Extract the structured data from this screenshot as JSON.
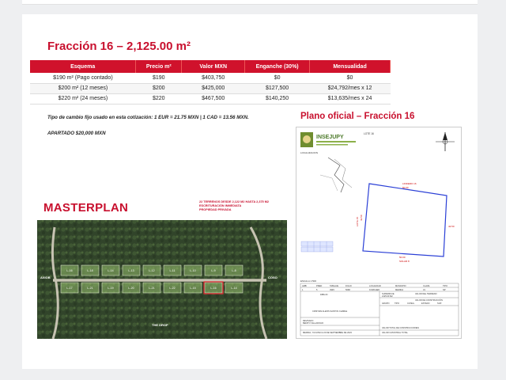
{
  "title": "Fracción 16 – 2,125.00 m²",
  "pricing": {
    "headers": [
      "Esquema",
      "Precio m²",
      "Valor MXN",
      "Enganche (30%)",
      "Mensualidad"
    ],
    "rows": [
      [
        "$190 m² (Pago contado)",
        "$190",
        "$403,750",
        "$0",
        "$0"
      ],
      [
        "$200 m² (12 meses)",
        "$200",
        "$425,000",
        "$127,500",
        "$24,792/mes x 12"
      ],
      [
        "$220 m² (24 meses)",
        "$220",
        "$467,500",
        "$140,250",
        "$13,635/mes x 24"
      ]
    ]
  },
  "exchange_note": "Tipo de cambio fijo usado en esta cotización: 1 EUR = 21.75 MXN | 1 CAD = 13.56 MXN.",
  "apartado": "APARTADO $20,000 MXN",
  "plano": {
    "title": "Plano oficial – Fracción 16",
    "logo_text": "INSEJUPY",
    "lote_label": "LOTE 16",
    "localizacion": "LOCALIZACION",
    "escala": "ESCALA 1:500",
    "edge_top": "LINDERO 16",
    "edge_left": "LOTE 15",
    "edge_bottom": "SOLAR 8",
    "dim_top": "50.00",
    "dim_right": "42.50",
    "dim_bottom": "50.00",
    "dim_left": "42.50",
    "cols": [
      "AMB",
      "PRED",
      "TABLAJE",
      "FOLIO",
      "LOCALIDAD",
      "MUNICIPIO",
      "CLAVE",
      "TIPO"
    ],
    "vals": [
      "1",
      "5",
      "3945",
      "5068",
      "KOMCHEN",
      "MERIDA",
      "31",
      "NP"
    ],
    "superficie_label": "SUPERFICIE",
    "superficie_value": "2125.00 M2",
    "valor_terreno": "VALOR DEL TERRENO",
    "valor_construccion": "VALOR DE CONSTRUCCIÓN",
    "construccion_cols": [
      "GRUPO",
      "TIPO",
      "CATEG.",
      "ESTADO",
      "SUP."
    ],
    "dibujo": "DIBUJO",
    "owner": "CRISTIAN ALEXIS SANTOS CHABLE",
    "revisado": "REVISADO",
    "revisor": "BENITO VALLADOLID",
    "place_date": "MERIDA, YUCATAN A 20 DE SEPTIEMBRE DE 2023",
    "valor_total": "VALOR TOTAL DE CONSTRUCCIONES",
    "valor_catastral": "VALOR CATASTRAL TOTAL"
  },
  "masterplan": {
    "title": "MASTERPLAN",
    "subtitle_lines": [
      "22 TERRENOS DESDE 2,122 M2 HASTA 2,375 M2",
      "ESCRITURACIÓN INMEDIATA",
      "PROPIEDAD PRIVADA"
    ],
    "label_left": "AXIOB",
    "label_right": "COSO",
    "label_bottom": "THE DROP",
    "lots_top": [
      "L-16",
      "L-18",
      "L-14",
      "L-13",
      "L-12",
      "L-11",
      "L-10",
      "L-9",
      "L-8"
    ],
    "lots_bottom": [
      "L-17",
      "L-21",
      "L-19",
      "L-20",
      "L-21",
      "L-22",
      "L-15",
      "L-16",
      "L-14"
    ],
    "highlight_color": "#e4222b"
  },
  "colors": {
    "brand_red": "#c8102e",
    "header_red": "#d0122c",
    "forest": "#2b3a22",
    "plot_blue": "#2a3fd6"
  }
}
